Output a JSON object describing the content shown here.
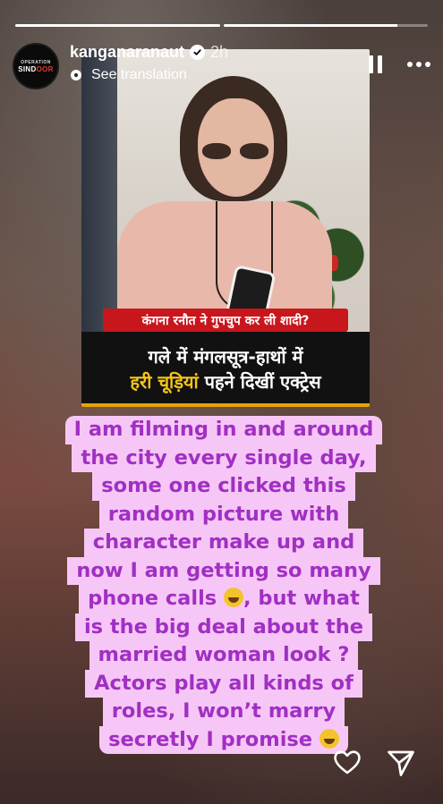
{
  "story": {
    "progress": [
      1.0,
      0.85
    ]
  },
  "header": {
    "avatar_text_small": "OPERATION",
    "avatar_text_big": "SIND",
    "avatar_text_big_accent": "OOR",
    "username": "kanganaranaut",
    "time": "2h",
    "see_translation": "See translation"
  },
  "image": {
    "banner_red": "कंगना रनौत ने गुपचुप कर ली शादी?",
    "banner_line1": "गले में मंगलसूत्र-हाथों में",
    "banner_line2_highlight": "हरी चूड़ियां",
    "banner_line2_rest": " पहने दिखीं एक्ट्रेस"
  },
  "caption": {
    "lines": [
      "I am filming in and around",
      "the city every single day,",
      "some one clicked this",
      "random picture with",
      "character make up and",
      "now I am getting so many",
      "phone calls",
      ", but what",
      "is the big deal about the",
      "married woman look ?",
      "Actors play all kinds of",
      "roles, I won’t marry",
      "secretly I promise"
    ]
  },
  "colors": {
    "caption_bg": "#f6c7f6",
    "caption_text": "#a12fc3",
    "banner_red": "#c8161d",
    "banner_highlight": "#f5c518"
  },
  "icons": {
    "verified": "verified-badge-icon",
    "translate": "translate-icon",
    "pause": "pause-icon",
    "more": "more-options-icon",
    "like": "heart-icon",
    "send": "send-icon"
  }
}
